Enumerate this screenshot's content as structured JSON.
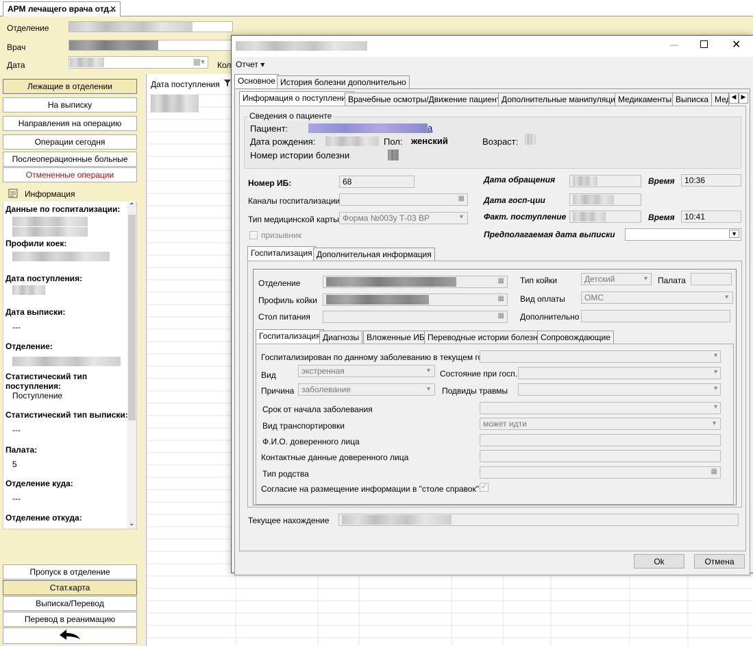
{
  "app": {
    "tab_title": "АРМ лечащего врача отд...",
    "tab_close": "✕",
    "fields": {
      "department_label": "Отделение",
      "doctor_label": "Врач",
      "date_label": "Дата",
      "kol_label": "Кол"
    },
    "sidebar": {
      "buttons": [
        "Лежащие в отделении",
        "На выписку",
        "Направления на операцию",
        "Операции сегодня",
        "Послеоперационные больные",
        "Отмененные операции"
      ],
      "info_title": "Информация",
      "info_items": [
        {
          "head": "Данные по госпитализации:",
          "value": ""
        },
        {
          "head": "Профили коек:",
          "value": ""
        },
        {
          "head": "Дата поступления:",
          "value": ""
        },
        {
          "head": "Дата выписки:",
          "value": "---"
        },
        {
          "head": "Отделение:",
          "value": ""
        },
        {
          "head": "Статистический тип поступления:",
          "value": "Поступление"
        },
        {
          "head": "Статистический тип выписки:",
          "value": "---"
        },
        {
          "head": "Палата:",
          "value": "5"
        },
        {
          "head": "Отделение куда:",
          "value": "---"
        },
        {
          "head": "Отделение откуда:",
          "value": ""
        }
      ],
      "bottom_buttons": [
        "Пропуск в отделение",
        "Стат.карта",
        "Выписка/Перевод",
        "Перевод в реанимацию"
      ]
    },
    "grid": {
      "header_label": "Дата поступления"
    }
  },
  "dialog": {
    "menu_report": "Отчет ▾",
    "top_tabs": [
      "Основное",
      "История болезни дополнительно"
    ],
    "section_tabs": [
      "Информация о поступлении",
      "Врачебные осмотры/Движение пациента",
      "Дополнительные манипуляции",
      "Медикаменты",
      "Выписка",
      "Мед"
    ],
    "patient": {
      "group_title": "Сведения о пациенте",
      "patient_label": "Пациент:",
      "patient_suffix": "а",
      "dob_label": "Дата рождения:",
      "sex_label": "Пол:",
      "sex_value": "женский",
      "age_label": "Возраст:",
      "history_label": "Номер истории болезни"
    },
    "admission": {
      "ib_label": "Номер ИБ:",
      "ib_value": "68",
      "channels_label": "Каналы госпитализации",
      "card_type_label": "Тип медицинской карты",
      "card_type_value": "Форма №003у Т-03 ВР",
      "conscript_label": "призывник",
      "appeal_date_label": "Дата обращения",
      "time_label": "Время",
      "appeal_time": "10:36",
      "hosp_date_label": "Дата госп-ции",
      "actual_label": "Факт. поступление",
      "actual_time": "10:41",
      "discharge_label": "Предполагаемая дата выписки"
    },
    "hosp_tabs": [
      "Госпитализация",
      "Дополнительная информация"
    ],
    "hosp": {
      "dept_label": "Отделение",
      "profile_label": "Профиль койки",
      "diet_label": "Стол питания",
      "bed_type_label": "Тип койки",
      "bed_type_value": "Детский",
      "ward_label": "Палата",
      "payment_label": "Вид оплаты",
      "payment_value": "ОМС",
      "extra_label": "Дополнительно"
    },
    "inner_tabs": [
      "Госпитализация",
      "Диагнозы",
      "Вложенные ИБ",
      "Переводные истории болезни",
      "Сопровождающие"
    ],
    "inner": {
      "repeat_label": "Госпитализирован по данному заболеванию в текущем году",
      "kind_label": "Вид",
      "kind_value": "экстренная",
      "state_label": "Состояние при госп.",
      "reason_label": "Причина",
      "reason_value": "заболевание",
      "trauma_label": "Подвиды травмы",
      "term_label": "Срок от начала заболевания",
      "transport_label": "Вид транспортировки",
      "transport_value": "может идти",
      "trustee_label": "Ф.И.О. доверенного лица",
      "contacts_label": "Контактные данные доверенного лица",
      "relation_label": "Тип родства",
      "consent_label": "Согласие на размещение информации в \"столе справок\""
    },
    "current_label": "Текущее нахождение",
    "ok": "Ok",
    "cancel": "Отмена"
  }
}
